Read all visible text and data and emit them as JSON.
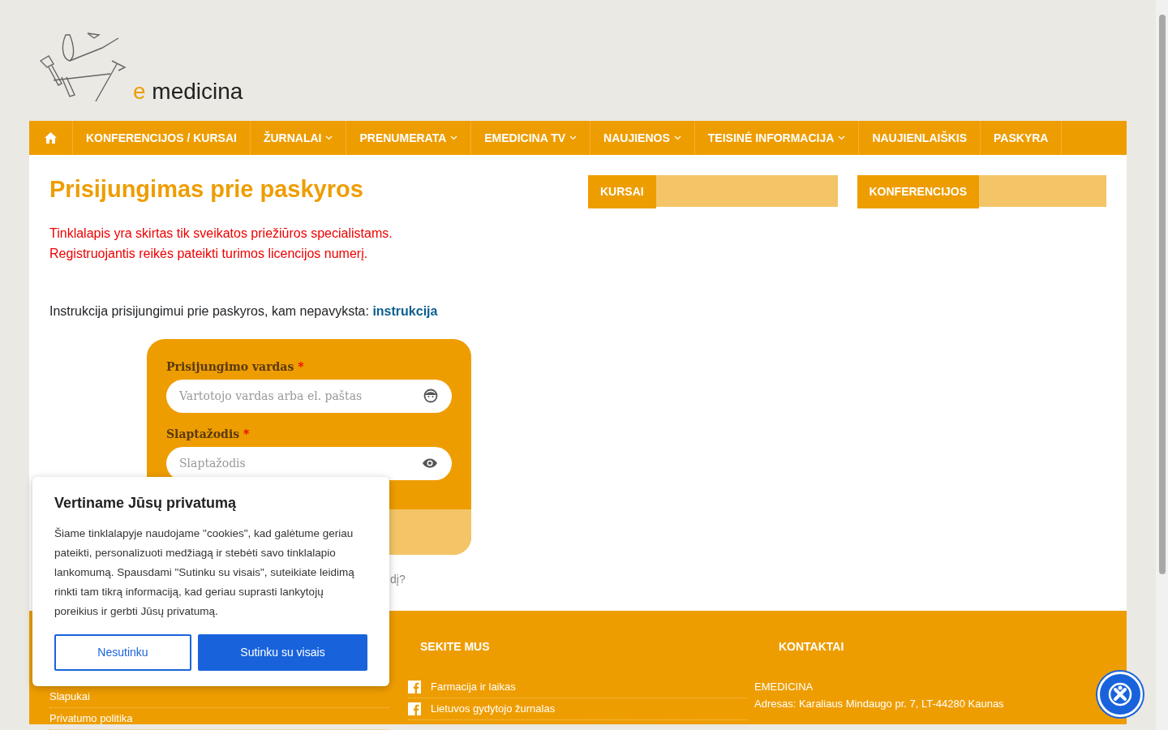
{
  "logo": {
    "prefix": "e",
    "name": "medicina"
  },
  "nav": [
    {
      "kind": "home"
    },
    {
      "kind": "link",
      "label": "KONFERENCIJOS / KURSAI",
      "dropdown": false
    },
    {
      "kind": "link",
      "label": "ŽURNALAI",
      "dropdown": true
    },
    {
      "kind": "link",
      "label": "PRENUMERATA",
      "dropdown": true
    },
    {
      "kind": "link",
      "label": "EMEDICINA TV",
      "dropdown": true
    },
    {
      "kind": "link",
      "label": "NAUJIENOS",
      "dropdown": true
    },
    {
      "kind": "link",
      "label": "TEISINĖ INFORMACIJA",
      "dropdown": true
    },
    {
      "kind": "link",
      "label": "NAUJIENLAIŠKIS",
      "dropdown": false
    },
    {
      "kind": "link",
      "label": "PASKYRA",
      "dropdown": false
    }
  ],
  "page": {
    "title": "Prisijungimas prie paskyros",
    "warning": [
      "Tinklalapis yra skirtas tik sveikatos priežiūros specialistams.",
      "Registruojantis reikės pateikti turimos licencijos numerį."
    ],
    "instruction": "Instrukcija prisijungimui prie paskyros, kam nepavyksta:",
    "instruction_link": "instrukcija"
  },
  "login_form": {
    "fields": [
      {
        "label": "Prisijungimo vardas",
        "required": "*",
        "placeholder": "Vartotojo vardas arba el. paštas",
        "kind": "user"
      },
      {
        "label": "Slaptažodis",
        "required": "*",
        "placeholder": "Slaptažodis",
        "kind": "password"
      }
    ],
    "forgot_link": "dį?"
  },
  "widgets": [
    {
      "title": "KURSAI"
    },
    {
      "title": "KONFERENCIJOS"
    }
  ],
  "footer": {
    "links": [
      "Slapukai",
      "Privatumo politika"
    ],
    "follow_title": "SEKITE MUS",
    "follow": [
      "Farmacija ir laikas",
      "Lietuvos gydytojo žurnalas"
    ],
    "contacts_title": "KONTAKTAI",
    "contacts": [
      "EMEDICINA",
      "Adresas: Karaliaus Mindaugo pr. 7, LT-44280 Kaunas"
    ]
  },
  "cookie_popup": {
    "title": "Vertiname Jūsų privatumą",
    "text": "Šiame tinklalapyje naudojame \"cookies\", kad galėtume geriau pateikti, personalizuoti medžiagą ir stebėti savo tinklalapio lankomumą. Spausdami \"Sutinku su visais\", suteikiate leidimą rinkti tam tikrą informaciją, kad geriau suprasti lankytojų poreikius ir gerbti Jūsų privatumą.",
    "buttons": [
      {
        "label": "Nesutinku",
        "kind": "outline"
      },
      {
        "label": "Sutinku su visais",
        "kind": "primary"
      }
    ]
  }
}
